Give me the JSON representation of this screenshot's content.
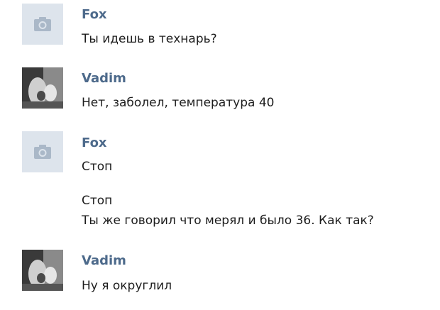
{
  "messages": [
    {
      "author": "Fox",
      "avatar_icon": "camera-icon",
      "lines": [
        "Ты идешь в технарь?"
      ]
    },
    {
      "author": "Vadim",
      "avatar_icon": "user-photo",
      "lines": [
        "Нет, заболел, температура 40"
      ]
    },
    {
      "author": "Fox",
      "avatar_icon": "camera-icon",
      "lines": [
        "Стоп",
        "Стоп",
        "Ты же говорил что мерял и было 36. Как так?"
      ]
    },
    {
      "author": "Vadim",
      "avatar_icon": "user-photo",
      "lines": [
        "Ну я округлил"
      ]
    }
  ],
  "colors": {
    "author_name": "#4d6a8b",
    "message_text": "#1d1d1d",
    "placeholder_avatar_bg": "#dde4ec",
    "placeholder_icon": "#aab8c8"
  }
}
